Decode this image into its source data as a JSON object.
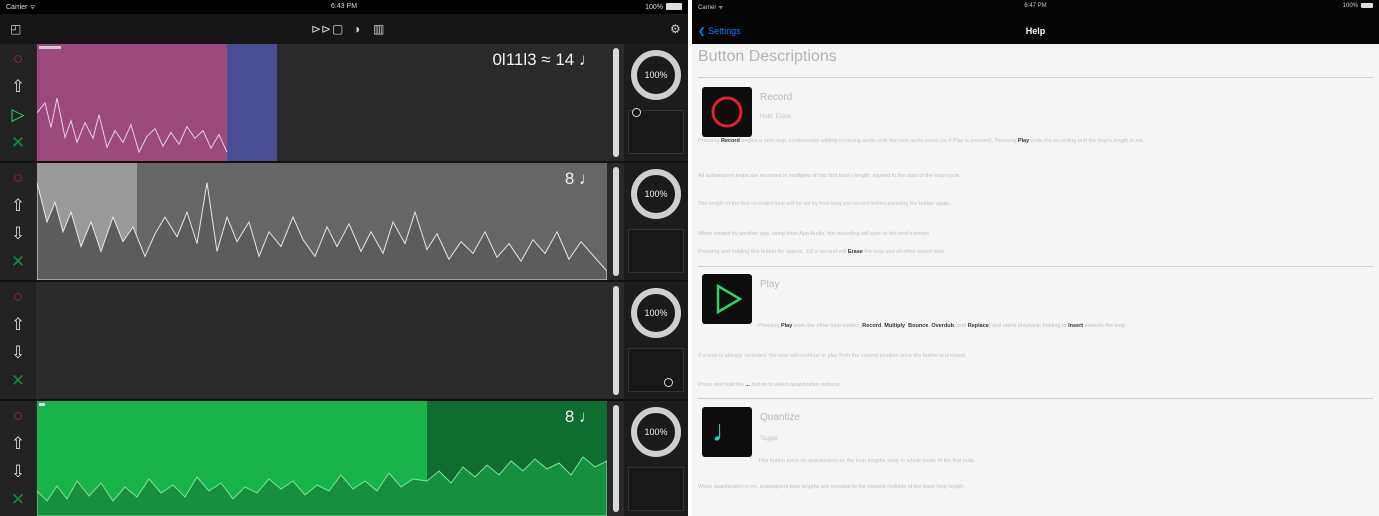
{
  "looper": {
    "status": {
      "carrier": "Carrier ᯤ",
      "time": "6:43 PM",
      "battery": "100%"
    },
    "toolbar_icons": [
      "square-icon",
      "skip-icon",
      "stop-icon",
      "contrast-icon",
      "trash-icon",
      "gear-icon"
    ],
    "tracks": [
      {
        "label": "0l11l3 ≈ 14 ♩",
        "volume": "100%",
        "color": "#b0508e",
        "accent": "#5a5fb0"
      },
      {
        "label": "8 ♩",
        "volume": "100%",
        "color": "#8c8c8c",
        "accent": "#b8b8b8"
      },
      {
        "label": "",
        "volume": "100%",
        "color": "#2a2a2a",
        "accent": "#2a2a2a"
      },
      {
        "label": "8 ♩",
        "volume": "100%",
        "color": "#18b34a",
        "accent": "#0e6b2d"
      }
    ]
  },
  "help": {
    "status": {
      "carrier": "Carrier ᯤ",
      "time": "6:47 PM",
      "battery": "100%"
    },
    "back_label": "Settings",
    "title": "Help",
    "heading": "Button Descriptions",
    "sections": [
      {
        "title": "Record",
        "subtitle": "Hold: Erase",
        "paragraphs": [
          [
            "Pressing ",
            "Record",
            " begins a new loop, continuously adding incoming audio until the next audio press (or if Play is pressed). Pressing ",
            "Play",
            " ends the recording and the loop's length is set."
          ],
          [
            "All subsequent loops are recorded in multiples of this first loop's length, aligned to the start of the loop cycle."
          ],
          [
            "The length of the first recorded loop will be set by how long you record before pressing the button again."
          ],
          [
            "When hosted by another app, using Inter-App Audio, the recording will sync to the host's tempo."
          ],
          [
            "Pressing and holding this button for approx. 1/2 a second will ",
            "Erase",
            " the loop and all other saved data."
          ]
        ]
      },
      {
        "title": "Play",
        "paragraphs": [
          [
            "Pressing ",
            "Play",
            " ends the other loop modes (",
            "Record",
            ", ",
            "Multiply",
            ", ",
            "Bounce",
            ", ",
            "Overdub",
            ", and ",
            "Replace",
            ") and starts playback; holding to ",
            "Insert",
            " extends the loop."
          ],
          [
            "If a loop is already recorded, the loop will continue to play from the current position once the button is pressed."
          ],
          [
            "Press and hold the ",
            "...",
            " button to select quantization options."
          ]
        ]
      },
      {
        "title": "Quantize",
        "subtitle": "Toggle",
        "paragraphs": [
          [
            "This button turns on quantization so the loop lengths snap to whole beats of the first loop."
          ],
          [
            "When quantization is on, subsequent loop lengths are rounded to the nearest multiple of the base loop length."
          ]
        ]
      }
    ]
  }
}
